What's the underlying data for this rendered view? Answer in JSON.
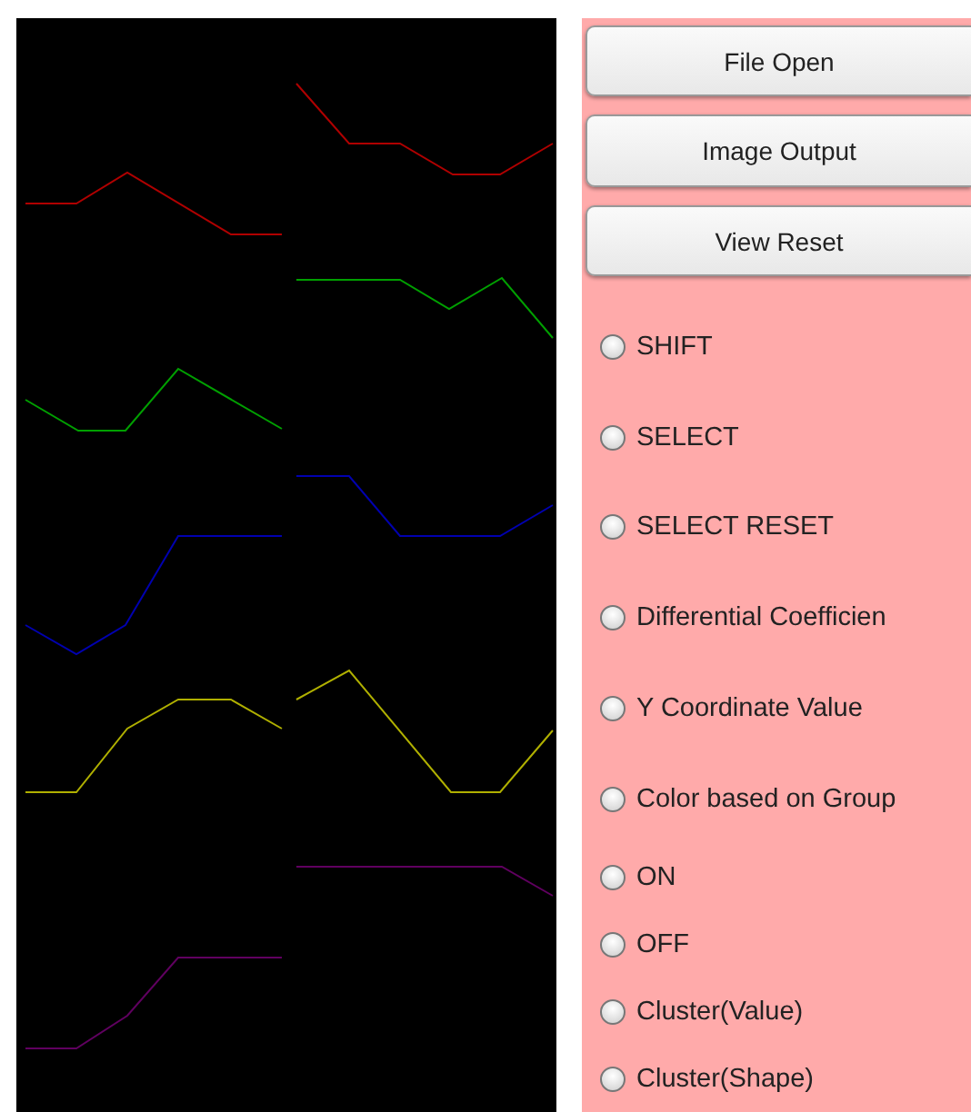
{
  "canvas": {
    "kind": "picture"
  },
  "buttons": [
    "File Open",
    "Image Output",
    "View Reset"
  ],
  "modes": [
    {
      "label": "SHIFT",
      "selected": false
    },
    {
      "label": "SELECT",
      "selected": false
    },
    {
      "label": "SELECT RESET",
      "selected": false
    },
    {
      "label": "Differential Coefficien",
      "selected": false
    },
    {
      "label": "Y Coordinate Value",
      "selected": false
    },
    {
      "label": "Color based on Group",
      "selected": false
    }
  ],
  "toggles": [
    {
      "label": "ON",
      "selected": false
    },
    {
      "label": "OFF",
      "selected": false
    },
    {
      "label": "Cluster(Value)",
      "selected": false
    },
    {
      "label": "Cluster(Shape)",
      "selected": false
    }
  ]
}
